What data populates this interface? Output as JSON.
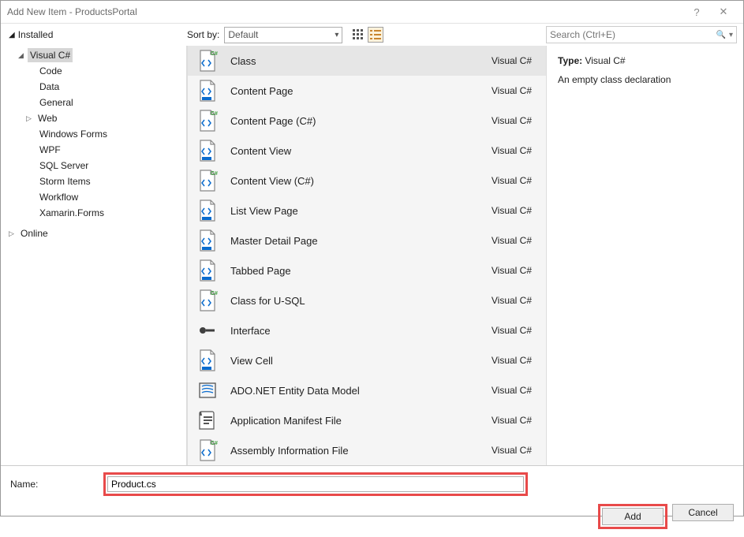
{
  "title": "Add New Item - ProductsPortal",
  "help_glyph": "?",
  "close_glyph": "✕",
  "tree": {
    "installed": "Installed",
    "visual_csharp": "Visual C#",
    "children": [
      "Code",
      "Data",
      "General",
      "Web",
      "Windows Forms",
      "WPF",
      "SQL Server",
      "Storm Items",
      "Workflow",
      "Xamarin.Forms"
    ],
    "online": "Online"
  },
  "sort": {
    "label": "Sort by:",
    "value": "Default"
  },
  "search": {
    "placeholder": "Search (Ctrl+E)"
  },
  "items": [
    {
      "label": "Class",
      "lang": "Visual C#",
      "icon": "cs-class",
      "selected": true
    },
    {
      "label": "Content Page",
      "lang": "Visual C#",
      "icon": "doc-blue"
    },
    {
      "label": "Content Page (C#)",
      "lang": "Visual C#",
      "icon": "cs-class"
    },
    {
      "label": "Content View",
      "lang": "Visual C#",
      "icon": "doc-blue"
    },
    {
      "label": "Content View (C#)",
      "lang": "Visual C#",
      "icon": "cs-class"
    },
    {
      "label": "List View Page",
      "lang": "Visual C#",
      "icon": "doc-blue"
    },
    {
      "label": "Master Detail Page",
      "lang": "Visual C#",
      "icon": "doc-blue"
    },
    {
      "label": "Tabbed Page",
      "lang": "Visual C#",
      "icon": "doc-blue"
    },
    {
      "label": "Class for U-SQL",
      "lang": "Visual C#",
      "icon": "cs-class"
    },
    {
      "label": "Interface",
      "lang": "Visual C#",
      "icon": "interface"
    },
    {
      "label": "View Cell",
      "lang": "Visual C#",
      "icon": "doc-blue"
    },
    {
      "label": "ADO.NET Entity Data Model",
      "lang": "Visual C#",
      "icon": "entity"
    },
    {
      "label": "Application Manifest File",
      "lang": "Visual C#",
      "icon": "manifest"
    },
    {
      "label": "Assembly Information File",
      "lang": "Visual C#",
      "icon": "cs-class"
    }
  ],
  "detail": {
    "type_label": "Type:",
    "type_value": "Visual C#",
    "description": "An empty class declaration"
  },
  "name": {
    "label": "Name:",
    "value": "Product.cs"
  },
  "buttons": {
    "add": "Add",
    "cancel": "Cancel"
  }
}
